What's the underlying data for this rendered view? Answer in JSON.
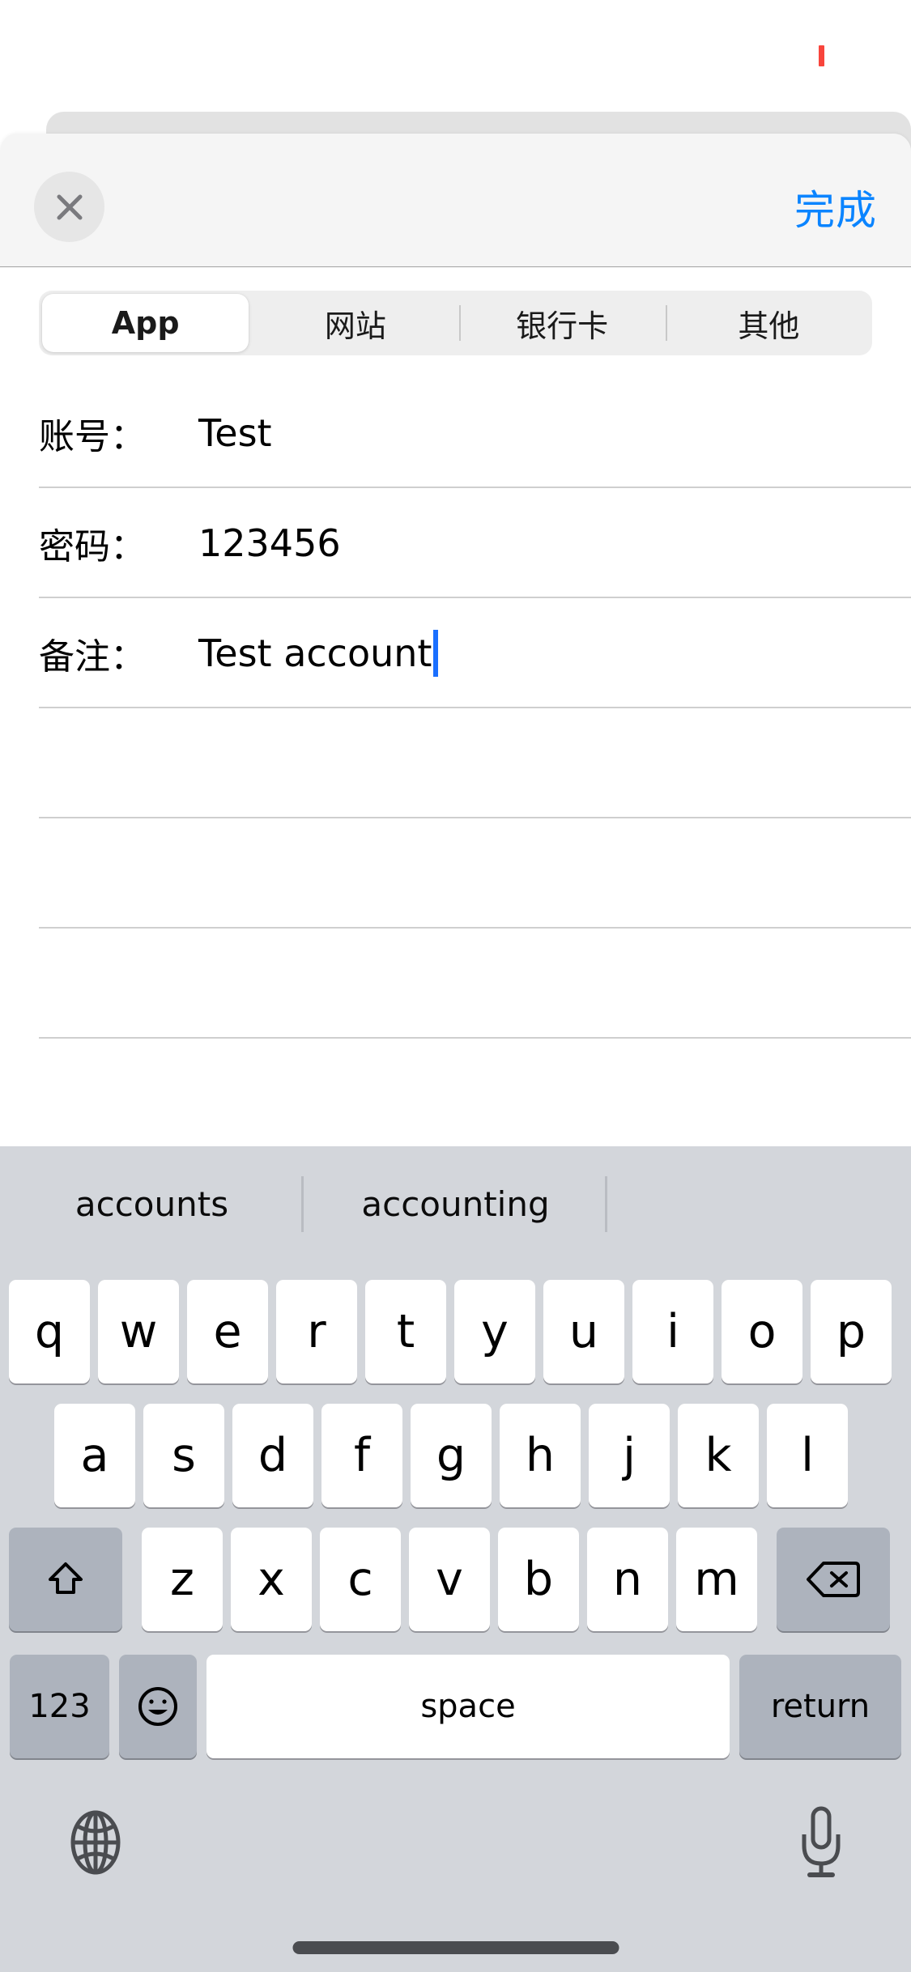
{
  "statusbar": {
    "indicator_color": "#f8453c"
  },
  "navbar": {
    "close_label": "",
    "done_label": "完成",
    "done_color": "#0a84ff",
    "background": "#f5f5f5"
  },
  "segmented": {
    "items": [
      {
        "label": "App",
        "selected": true
      },
      {
        "label": "网站",
        "selected": false
      },
      {
        "label": "银行卡",
        "selected": false
      },
      {
        "label": "其他",
        "selected": false
      }
    ]
  },
  "form": {
    "rows": [
      {
        "label": "账号：",
        "value": "Test",
        "focused": false
      },
      {
        "label": "密码：",
        "value": "123456",
        "focused": false
      },
      {
        "label": "备注：",
        "value": "Test account",
        "focused": true
      },
      {
        "label": "",
        "value": "",
        "focused": false
      },
      {
        "label": "",
        "value": "",
        "focused": false
      },
      {
        "label": "",
        "value": "",
        "focused": false
      }
    ],
    "caret_color": "#1a6fff"
  },
  "keyboard": {
    "background": "#d3d6db",
    "suggestions": [
      "accounts",
      "accounting",
      ""
    ],
    "row1": [
      "q",
      "w",
      "e",
      "r",
      "t",
      "y",
      "u",
      "i",
      "o",
      "p"
    ],
    "row2": [
      "a",
      "s",
      "d",
      "f",
      "g",
      "h",
      "j",
      "k",
      "l"
    ],
    "row3_letters": [
      "z",
      "x",
      "c",
      "v",
      "b",
      "n",
      "m"
    ],
    "shift_icon": "shift-arrow-icon",
    "delete_icon": "delete-backspace-icon",
    "numbers_label": "123",
    "emoji_icon": "emoji-smiley-icon",
    "space_label": "space",
    "return_label": "return",
    "globe_icon": "globe-icon",
    "mic_icon": "microphone-icon"
  }
}
